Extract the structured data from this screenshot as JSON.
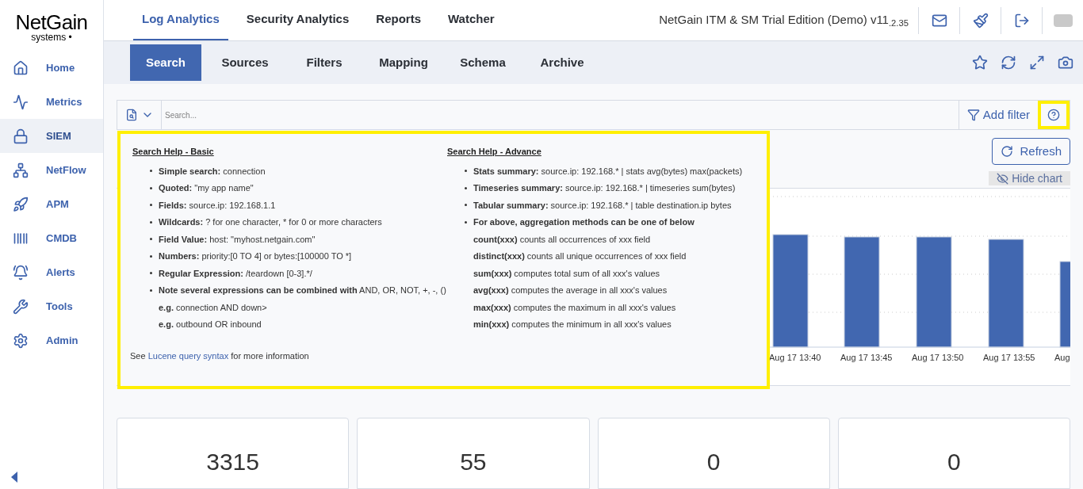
{
  "logo": {
    "name": "NetGain",
    "tagline": "systems •"
  },
  "sidebar": {
    "items": [
      {
        "label": "Home",
        "selected": false
      },
      {
        "label": "Metrics",
        "selected": false
      },
      {
        "label": "SIEM",
        "selected": true
      },
      {
        "label": "NetFlow",
        "selected": false
      },
      {
        "label": "APM",
        "selected": false
      },
      {
        "label": "CMDB",
        "selected": false
      },
      {
        "label": "Alerts",
        "selected": false
      },
      {
        "label": "Tools",
        "selected": false
      },
      {
        "label": "Admin",
        "selected": false
      }
    ]
  },
  "top_tabs": [
    {
      "label": "Log Analytics",
      "selected": true
    },
    {
      "label": "Security Analytics",
      "selected": false
    },
    {
      "label": "Reports",
      "selected": false
    },
    {
      "label": "Watcher",
      "selected": false
    }
  ],
  "edition": "NetGain ITM & SM Trial Edition (Demo) v11$_{.2.35}$",
  "sub_tabs": [
    {
      "label": "Search",
      "selected": true
    },
    {
      "label": "Sources",
      "selected": false
    },
    {
      "label": "Filters",
      "selected": false
    },
    {
      "label": "Mapping",
      "selected": false
    },
    {
      "label": "Schema",
      "selected": false
    },
    {
      "label": "Archive",
      "selected": false
    }
  ],
  "search": {
    "placeholder": "Search...",
    "add_filter": "Add filter",
    "help_highlighted": true
  },
  "help": {
    "highlighted": true,
    "basic": {
      "title": "Search Help - Basic",
      "items": [
        {
          "kind": "bullet",
          "text": "**Simple search:** connection"
        },
        {
          "kind": "bullet",
          "text": "**Quoted:** \"my app name\""
        },
        {
          "kind": "bullet",
          "text": "**Fields:** source.ip: 192.168.1.1"
        },
        {
          "kind": "bullet",
          "text": "**Wildcards:** ? for one character, * for 0 or more characters"
        },
        {
          "kind": "bullet",
          "text": "**Field Value:** host: \"myhost.netgain.com\""
        },
        {
          "kind": "bullet",
          "text": "**Numbers:** priority:[0 TO 4] or bytes:[100000 TO *]"
        },
        {
          "kind": "bullet",
          "text": "**Regular Expression:** /teardown [0-3].*/"
        },
        {
          "kind": "bullet",
          "text": "**Note several expressions can be combined with** AND, OR, NOT, +, -, ()"
        },
        {
          "kind": "plain",
          "text": "**e.g.** connection AND down>"
        },
        {
          "kind": "plain",
          "text": "**e.g.** outbound OR inbound"
        }
      ]
    },
    "advance": {
      "title": "Search Help - Advance",
      "items": [
        {
          "kind": "bullet",
          "text": "**Stats summary:** source.ip: 192.168.* | stats avg(bytes) max(packets)"
        },
        {
          "kind": "bullet",
          "text": "**Timeseries summary:** source.ip: 192.168.* | timeseries sum(bytes)"
        },
        {
          "kind": "bullet",
          "text": "**Tabular summary:** source.ip: 192.168.* | table destination.ip bytes"
        },
        {
          "kind": "bullet",
          "text": "**For above, aggregation methods can be one of below**"
        },
        {
          "kind": "plain",
          "text": "**count(xxx)** counts all occurrences of xxx field"
        },
        {
          "kind": "plain",
          "text": "**distinct(xxx)** counts all unique occurrences of xxx field"
        },
        {
          "kind": "plain",
          "text": "**sum(xxx)** computes total sum of all xxx's values"
        },
        {
          "kind": "plain",
          "text": "**avg(xxx)** computes the average in all xxx's values"
        },
        {
          "kind": "plain",
          "text": "**max(xxx)** computes the maximum in all xxx's values"
        },
        {
          "kind": "plain",
          "text": "**min(xxx)** computes the minimum in all xxx's values"
        }
      ]
    },
    "footer": {
      "before": "See",
      "link": "Lucene query syntax",
      "after": "for more information"
    }
  },
  "refresh": "Refresh",
  "hide_chart": "Hide chart",
  "chart": {
    "x_labels": [
      "Aug 17 13:40",
      "Aug 17 13:45",
      "Aug 17 13:50",
      "Aug 17 13:55",
      "Aug"
    ]
  },
  "cards": [
    {
      "value": "3315"
    },
    {
      "value": "55"
    },
    {
      "value": "0"
    },
    {
      "value": "0"
    }
  ]
}
